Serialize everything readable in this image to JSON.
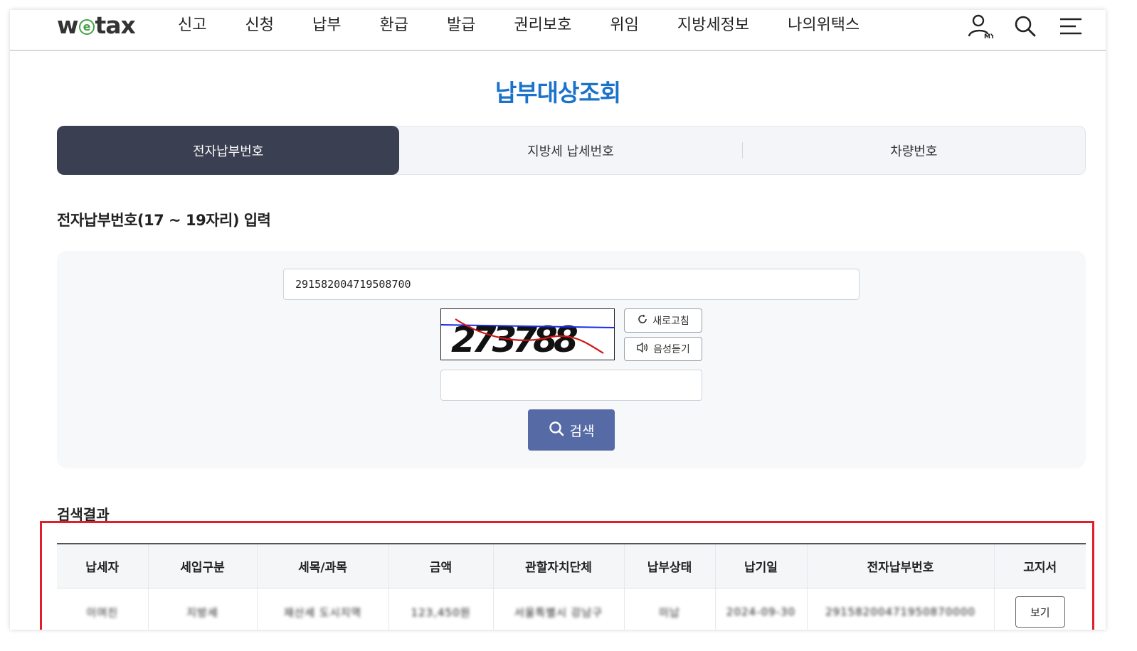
{
  "header": {
    "logo": {
      "pre": "w",
      "e": "e",
      "post": "tax"
    },
    "nav": [
      "신고",
      "신청",
      "납부",
      "환급",
      "발급",
      "권리보호",
      "위임",
      "지방세정보",
      "나의위택스"
    ],
    "icons": [
      "user-my-icon",
      "search-icon",
      "menu-icon"
    ],
    "my_badge": "MY"
  },
  "page_title": "납부대상조회",
  "tabs": [
    {
      "label": "전자납부번호",
      "active": true
    },
    {
      "label": "지방세 납세번호",
      "active": false
    },
    {
      "label": "차량번호",
      "active": false
    }
  ],
  "section_label": "전자납부번호(17 ~ 19자리) 입력",
  "form": {
    "epay_number": "291582004719508700",
    "captcha_text": "273788",
    "refresh_label": "새로고침",
    "audio_label": "음성듣기",
    "captcha_input": "",
    "search_label": "검색"
  },
  "results": {
    "label": "검색결과",
    "columns": [
      "납세자",
      "세입구분",
      "세목/과목",
      "금액",
      "관할자치단체",
      "납부상태",
      "납기일",
      "전자납부번호",
      "고지서"
    ],
    "rows": [
      {
        "taxpayer": "이여진",
        "revenue_type": "지방세",
        "tax_item": "재산세 도시지역",
        "amount": "123,450원",
        "jurisdiction": "서울특별시 강남구",
        "status": "미납",
        "due_date": "2024-09-30",
        "epay_no": "29158200471950870000",
        "notice_label": "보기"
      }
    ]
  },
  "colors": {
    "accent": "#1a73c9",
    "active_tab": "#3b3f52",
    "search_button": "#566aa5",
    "highlight": "#e11f2a"
  }
}
